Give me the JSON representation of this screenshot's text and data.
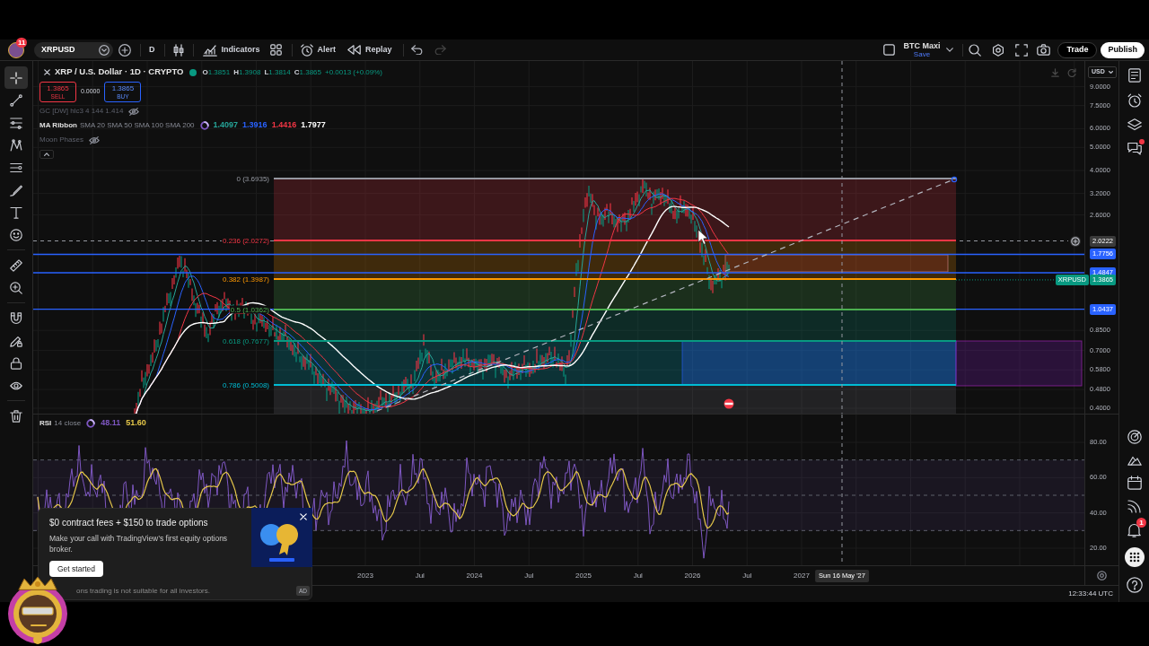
{
  "toolbar": {
    "avatar_badge": "11",
    "symbol": "XRPUSD",
    "interval": "D",
    "buttons": [
      {
        "kind": "indicators",
        "label": "Indicators"
      },
      {
        "kind": "alert",
        "label": "Alert"
      },
      {
        "kind": "replay",
        "label": "Replay"
      }
    ],
    "undo": {
      "disabled": false
    },
    "redo": {
      "disabled": true
    },
    "layout_name": "BTC Maxi",
    "layout_status": "Save",
    "trade": "Trade",
    "publish": "Publish"
  },
  "left_toolbar": {
    "tools": [
      {
        "selected": true
      },
      {
        "selected": false
      },
      {
        "selected": false
      },
      {
        "selected": false
      },
      {
        "selected": false
      },
      {
        "selected": false
      },
      {
        "selected": false
      },
      {
        "selected": false
      },
      {
        "selected": false
      },
      {
        "selected": false
      },
      {
        "selected": false
      },
      {
        "selected": false
      },
      {
        "selected": false
      },
      {
        "selected": false
      },
      {
        "selected": false
      }
    ]
  },
  "legend": {
    "title": "XRP / U.S. Dollar · 1D · CRYPTO",
    "market_open": true,
    "ohlc": [
      {
        "label": "O",
        "value": "1.3851"
      },
      {
        "label": "H",
        "value": "1.3908"
      },
      {
        "label": "L",
        "value": "1.3814"
      },
      {
        "label": "C",
        "value": "1.3865"
      }
    ],
    "change": "+0.0013 (+0.09%)",
    "sell": {
      "price": "1.3865",
      "label": "SELL"
    },
    "spread": "0.0000",
    "buy": {
      "price": "1.3865",
      "label": "BUY"
    }
  },
  "indicators": [
    {
      "name": "GC [DW] hlc3 4 144 1.414",
      "hidden": true,
      "loading": false
    },
    {
      "name": "MA Ribbon",
      "params": "SMA 20 SMA 50 SMA 100 SMA 200",
      "hidden": false,
      "loading": true,
      "values": [
        {
          "value": "1.4097",
          "color": "#26a69a"
        },
        {
          "value": "1.3916",
          "color": "#2962ff"
        },
        {
          "value": "1.4416",
          "color": "#f23645"
        },
        {
          "value": "1.7977",
          "color": "#ffffff"
        }
      ]
    },
    {
      "name": "Moon Phases",
      "hidden": true,
      "loading": false
    }
  ],
  "fib_levels": [
    {
      "label": "0 (3.6935)",
      "color": "#9598a1"
    },
    {
      "label": "0.236 (2.0272)",
      "color": "#f23645"
    },
    {
      "label": "0.382 (1.3987)",
      "color": "#ff9800"
    },
    {
      "label": "0.5 (1.0362)",
      "color": "#4caf50"
    },
    {
      "label": "0.618 (0.7677)",
      "color": "#089981"
    },
    {
      "label": "0.786 (0.5008)",
      "color": "#00bcd4"
    }
  ],
  "price_axis": {
    "currency": "USD",
    "ticks": [
      "9.0000",
      "7.5000",
      "6.0000",
      "5.0000",
      "4.0000",
      "3.2000",
      "2.6000",
      "0.8500",
      "0.7000",
      "0.5800",
      "0.4800",
      "0.4000"
    ]
  },
  "price_markers": [
    {
      "kind": "crosshair",
      "value": "2.0222"
    },
    {
      "kind": "line",
      "value": "1.7756",
      "color": "#2962ff"
    },
    {
      "kind": "line",
      "value": "1.4847",
      "color": "#2962ff"
    },
    {
      "kind": "last",
      "label": "XRPUSD",
      "value": "1.3865",
      "color": "#089981"
    },
    {
      "kind": "line",
      "value": "1.0437",
      "color": "#2962ff"
    }
  ],
  "rsi": {
    "name": "RSI",
    "params": "14 close",
    "loading": true,
    "values": [
      {
        "value": "48.11",
        "color": "#7e57c2"
      },
      {
        "value": "51.60",
        "color": "#e6c84a"
      }
    ],
    "ticks": [
      "80.00",
      "60.00",
      "40.00",
      "20.00"
    ]
  },
  "time_axis": {
    "labels": [
      "2023",
      "Jul",
      "2024",
      "Jul",
      "2025",
      "Jul",
      "2026",
      "Jul",
      "2027"
    ],
    "crosshair_date": "Sun 16 May '27"
  },
  "status_bar": {
    "time": "12:33:44 UTC"
  },
  "ad": {
    "title": "$0 contract fees + $150 to trade options",
    "body": "Make your call with TradingView’s first equity options broker.",
    "button": "Get started",
    "disclaimer": "ons trading is not suitable for all investors.",
    "tag": "AD"
  },
  "right_sidebar": {
    "chat_unread": true,
    "alerts_badge": "1"
  }
}
